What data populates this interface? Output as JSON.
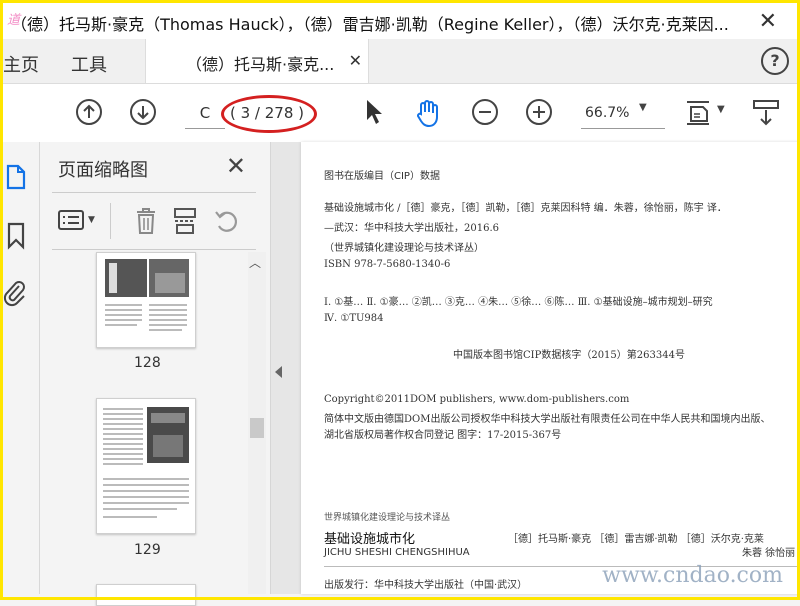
{
  "window": {
    "title": "（德）托马斯·豪克（Thomas Hauck），（德）雷吉娜·凯勒（Regine Keller），（德）沃尔克·克莱因..."
  },
  "tabs": {
    "home": "主页",
    "tools": "工具",
    "doc_title": "（德）托马斯·豪克..."
  },
  "toolbar": {
    "page_input": "C",
    "page_count": "( 3 / 278 )",
    "zoom": "66.7%"
  },
  "thumbnails": {
    "title": "页面缩略图",
    "pages": [
      {
        "label": "128"
      },
      {
        "label": "129"
      }
    ]
  },
  "document": {
    "cip_heading": "图书在版编目（CIP）数据",
    "cip_line1": "基础设施城市化 /［德］豪克，［德］凯勒，［德］克莱因科特 编．朱蓉，徐怡丽，陈宇 译．",
    "cip_line2": "—武汉：华中科技大学出版社，2016.6",
    "cip_line3": "（世界城镇化建设理论与技术译丛）",
    "cip_isbn": "ISBN 978-7-5680-1340-6",
    "cip_class1": "Ⅰ. ①基… Ⅱ. ①豪… ②凯… ③克… ④朱… ⑤徐… ⑥陈… Ⅲ. ①基础设施–城市规划–研究",
    "cip_class2": "Ⅳ. ①TU984",
    "cip_core": "中国版本图书馆CIP数据核字（2015）第263344号",
    "copyright": "Copyright©2011DOM publishers, www.dom-publishers.com",
    "license1": "简体中文版由德国DOM出版公司授权华中科技大学出版社有限责任公司在中华人民共和国境内出版、",
    "license2": "湖北省版权局著作权合同登记 图字：17-2015-367号",
    "series": "世界城镇化建设理论与技术译丛",
    "book_title": "基础设施城市化",
    "book_pinyin": "JICHU SHESHI CHENGSHIHUA",
    "authors": "［德］托马斯·豪克 ［德］雷吉娜·凯勒 ［德］沃尔克·克莱",
    "translators": "朱蓉 徐怡丽",
    "publisher": "出版发行：华中科技大学出版社（中国·武汉）"
  },
  "watermark": "www.cndao.com",
  "colors": {
    "highlight_oval": "#d42020",
    "frame": "#ffe600",
    "accent_blue": "#1473e6"
  },
  "icons": [
    "prev-page-icon",
    "next-page-icon",
    "select-arrow-icon",
    "hand-tool-icon",
    "zoom-out-icon",
    "zoom-in-icon",
    "fit-page-icon",
    "scroll-mode-icon",
    "help-icon"
  ]
}
